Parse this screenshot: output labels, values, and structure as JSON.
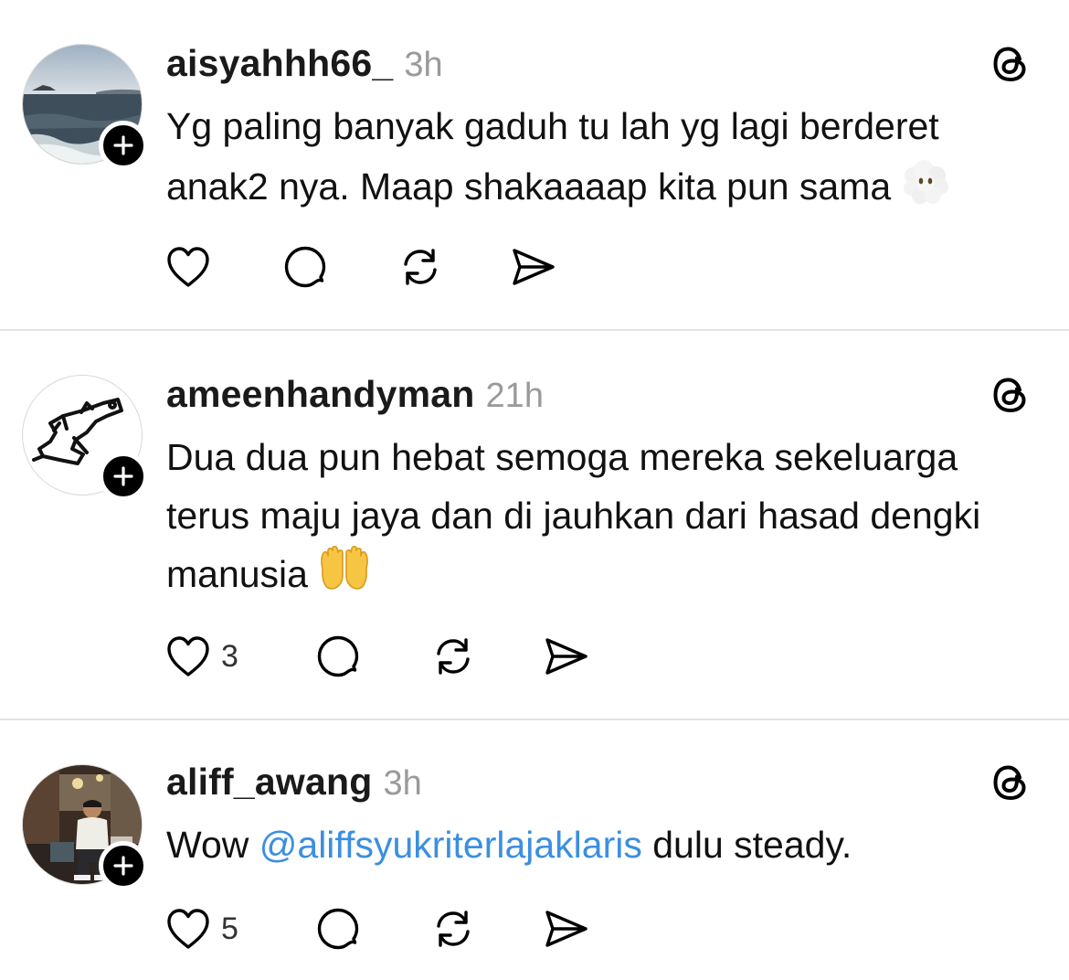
{
  "colors": {
    "mention": "#3b8fe0",
    "time": "#9a9a9a",
    "divider": "#e3e3e3"
  },
  "icons": [
    "threads-logo-icon",
    "heart-icon",
    "comment-icon",
    "repost-icon",
    "share-icon",
    "follow-plus-icon"
  ],
  "posts": [
    {
      "username": "aisyahhh66_",
      "time": "3h",
      "text": "Yg paling banyak gaduh tu lah yg lagi berderet anak2 nya. Maap shakaaaap kita pun sama",
      "emoji": "face-with-clouds",
      "likes": ""
    },
    {
      "username": "ameenhandyman",
      "time": "21h",
      "text": "Dua dua pun hebat semoga mereka sekeluarga terus maju jaya dan di jauhkan dari hasad dengki manusia",
      "emoji": "open-hands",
      "likes": "3"
    },
    {
      "username": "aliff_awang",
      "time": "3h",
      "text_before": "Wow ",
      "mention": "@aliffsyukriterlajaklaris",
      "text_after": " dulu steady.",
      "likes": "5"
    }
  ]
}
